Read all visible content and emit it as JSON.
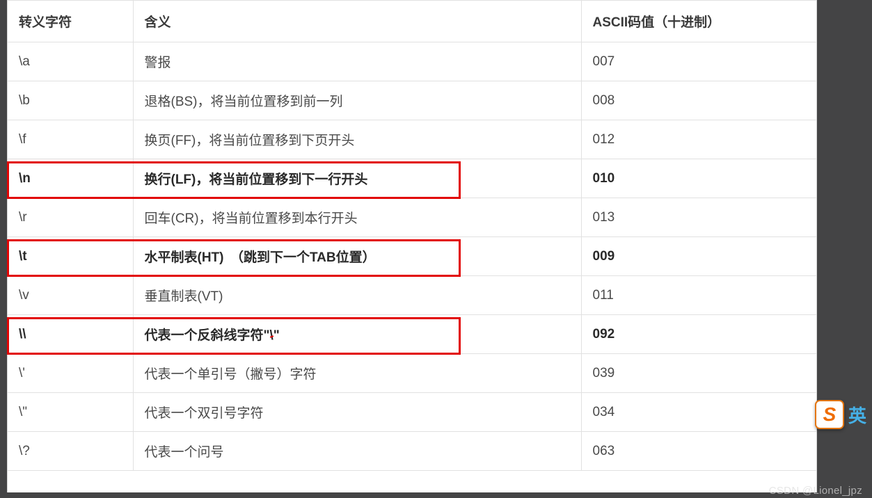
{
  "table": {
    "headers": [
      "转义字符",
      "含义",
      "ASCII码值（十进制）"
    ],
    "rows": [
      {
        "esc": "\\a",
        "meaning": "警报",
        "ascii": "007",
        "emph": false
      },
      {
        "esc": "\\b",
        "meaning": "退格(BS)，将当前位置移到前一列",
        "ascii": "008",
        "emph": false
      },
      {
        "esc": "\\f",
        "meaning": "换页(FF)，将当前位置移到下页开头",
        "ascii": "012",
        "emph": false
      },
      {
        "esc": "\\n",
        "meaning": "换行(LF)，将当前位置移到下一行开头",
        "ascii": "010",
        "emph": true
      },
      {
        "esc": "\\r",
        "meaning": "回车(CR)，将当前位置移到本行开头",
        "ascii": "013",
        "emph": false
      },
      {
        "esc": "\\t",
        "meaning": "水平制表(HT)　（跳到下一个TAB位置）",
        "ascii": "009",
        "emph": true
      },
      {
        "esc": "\\v",
        "meaning": "垂直制表(VT)",
        "ascii": "011",
        "emph": false
      },
      {
        "esc": "\\\\",
        "meaning_pre": "代表一个反斜线字符\"",
        "meaning_strike": "\\",
        "meaning_post": "\"",
        "ascii": "092",
        "emph": true,
        "strike": true
      },
      {
        "esc": "\\'",
        "meaning": "代表一个单引号（撇号）字符",
        "ascii": "039",
        "emph": false
      },
      {
        "esc": "\\\"",
        "meaning": "代表一个双引号字符",
        "ascii": "034",
        "emph": false
      },
      {
        "esc": "\\?",
        "meaning": "代表一个问号",
        "ascii": "063",
        "emph": false
      }
    ]
  },
  "sogou": {
    "s": "S",
    "label": "英"
  },
  "watermark": "CSDN @Lionel_jpz"
}
